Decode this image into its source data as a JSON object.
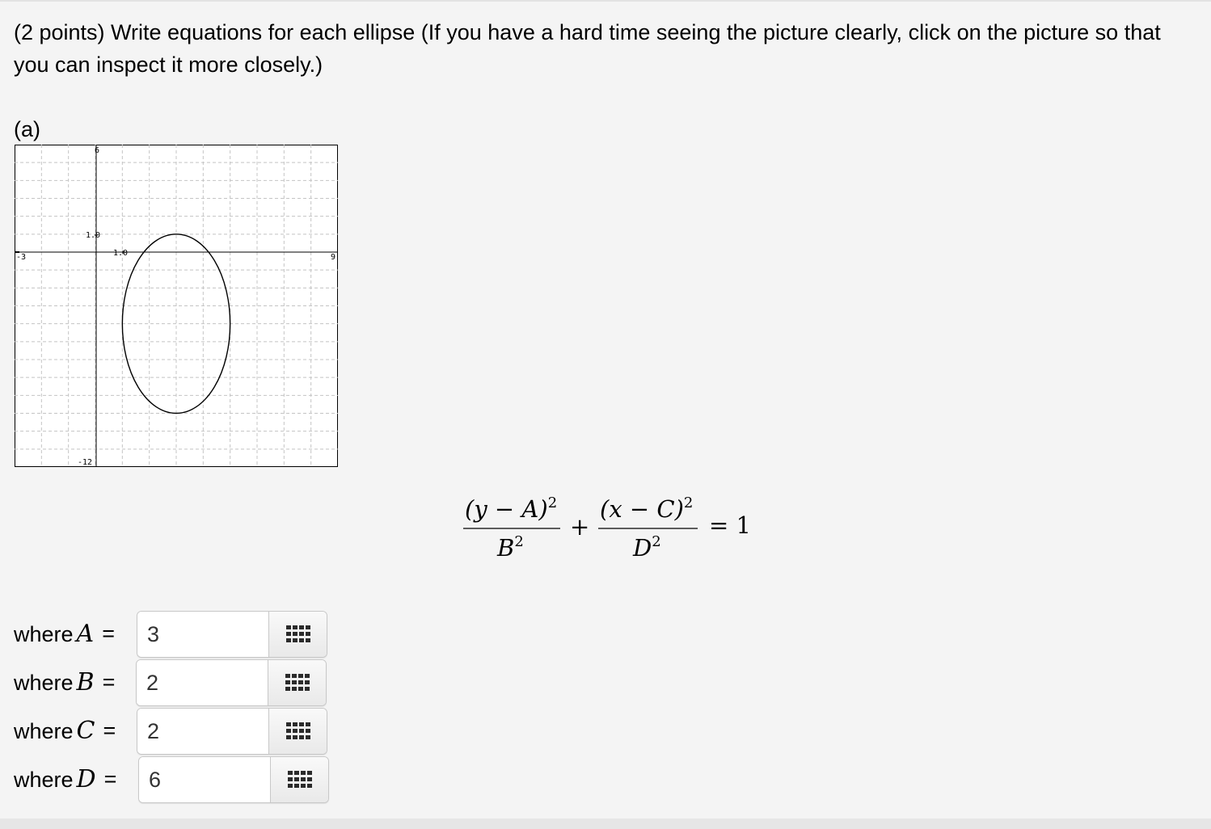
{
  "question": {
    "text": "(2 points) Write equations for each ellipse (If you have a hard time seeing the picture clearly, click on the picture so that you can inspect it more closely.)"
  },
  "part": {
    "label": "(a)"
  },
  "graph": {
    "x_min_label": "-3",
    "x_max_label": "9",
    "y_max_label": "6",
    "y_min_label": "-12",
    "x_tick_label": "1.0",
    "y_tick_label": "1.0",
    "x_range": [
      -3,
      9
    ],
    "y_range": [
      -12,
      6
    ],
    "grid": true,
    "ellipse": {
      "center_x": 3,
      "center_y": -4,
      "semi_axis_x": 2,
      "semi_axis_y": 5
    }
  },
  "equation": {
    "num1": "(y − A)",
    "den1_var": "B",
    "plus": "+",
    "num2": "(x − C)",
    "den2_var": "D",
    "exponent": "2",
    "equals": "= 1"
  },
  "answers": [
    {
      "prefix": "where",
      "var": "A",
      "equals": "=",
      "value": "3"
    },
    {
      "prefix": "where",
      "var": "B",
      "equals": "=",
      "value": "2"
    },
    {
      "prefix": "where",
      "var": "C",
      "equals": "=",
      "value": "2"
    },
    {
      "prefix": "where",
      "var": "D",
      "equals": "=",
      "value": "6"
    }
  ],
  "palette_icon": "equation-palette-icon"
}
